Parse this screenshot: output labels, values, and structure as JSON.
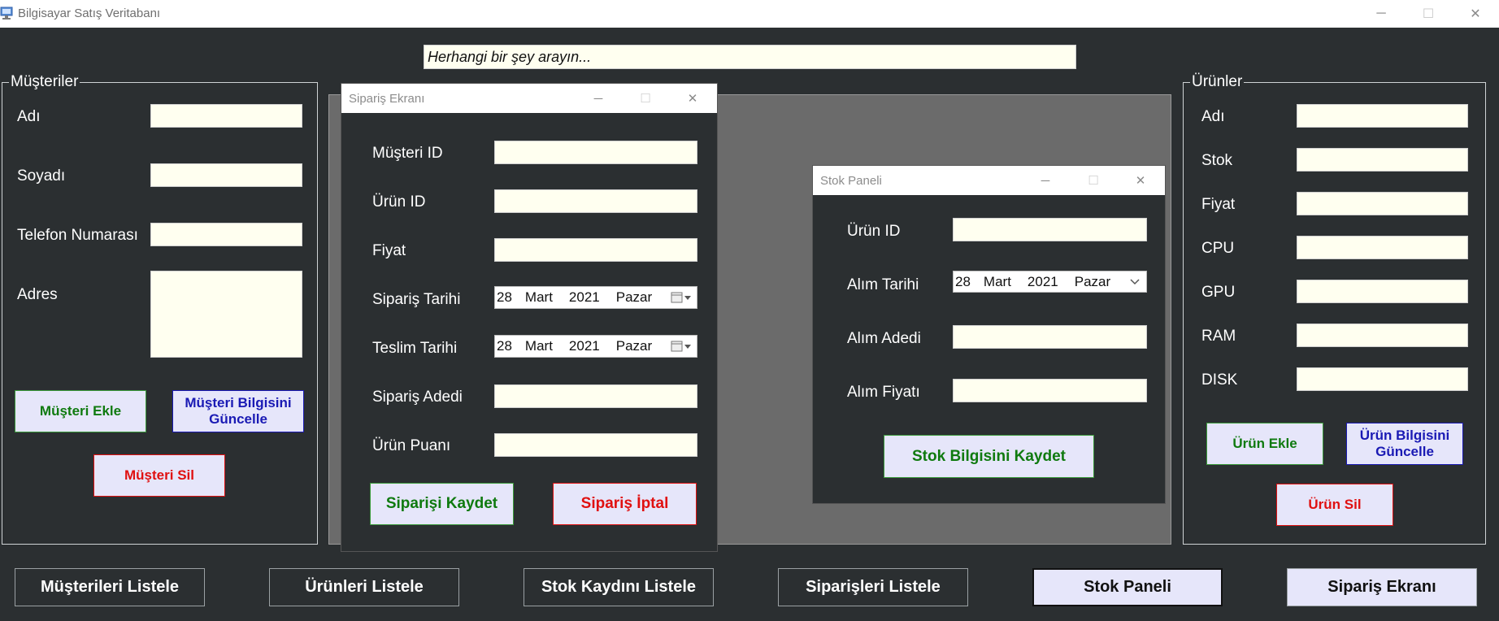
{
  "window": {
    "title": "Bilgisayar Satış Veritabanı",
    "minimize": "─",
    "maximize": "☐",
    "close": "✕"
  },
  "search": {
    "placeholder": "Herhangi bir şey arayın..."
  },
  "customers": {
    "legend": "Müşteriler",
    "labels": {
      "name": "Adı",
      "surname": "Soyadı",
      "phone": "Telefon Numarası",
      "address": "Adres"
    },
    "buttons": {
      "add": "Müşteri Ekle",
      "update": "Müşteri Bilgisini Güncelle",
      "delete": "Müşteri Sil"
    }
  },
  "products": {
    "legend": "Ürünler",
    "labels": {
      "name": "Adı",
      "stock": "Stok",
      "price": "Fiyat",
      "cpu": "CPU",
      "gpu": "GPU",
      "ram": "RAM",
      "disk": "DISK"
    },
    "buttons": {
      "add": "Ürün Ekle",
      "update": "Ürün Bilgisini Güncelle",
      "delete": "Ürün Sil"
    }
  },
  "order_window": {
    "title": "Sipariş Ekranı",
    "labels": {
      "customer_id": "Müşteri ID",
      "product_id": "Ürün ID",
      "price": "Fiyat",
      "order_date": "Sipariş Tarihi",
      "delivery_date": "Teslim Tarihi",
      "quantity": "Sipariş Adedi",
      "rating": "Ürün Puanı"
    },
    "order_date": {
      "day": "28",
      "month": "Mart",
      "year": "2021",
      "weekday": "Pazar"
    },
    "delivery_date": {
      "day": "28",
      "month": "Mart",
      "year": "2021",
      "weekday": "Pazar"
    },
    "buttons": {
      "save": "Siparişi Kaydet",
      "cancel": "Sipariş İptal"
    }
  },
  "stock_window": {
    "title": "Stok Paneli",
    "labels": {
      "product_id": "Ürün ID",
      "purchase_date": "Alım Tarihi",
      "purchase_qty": "Alım Adedi",
      "purchase_price": "Alım Fiyatı"
    },
    "purchase_date": {
      "day": "28",
      "month": "Mart",
      "year": "2021",
      "weekday": "Pazar"
    },
    "buttons": {
      "save": "Stok Bilgisini Kaydet"
    }
  },
  "bottom_bar": {
    "list_customers": "Müşterileri Listele",
    "list_products": "Ürünleri Listele",
    "list_stock": "Stok Kaydını Listele",
    "list_orders": "Siparişleri Listele",
    "stock_panel": "Stok Paneli",
    "order_screen": "Sipariş Ekranı"
  }
}
